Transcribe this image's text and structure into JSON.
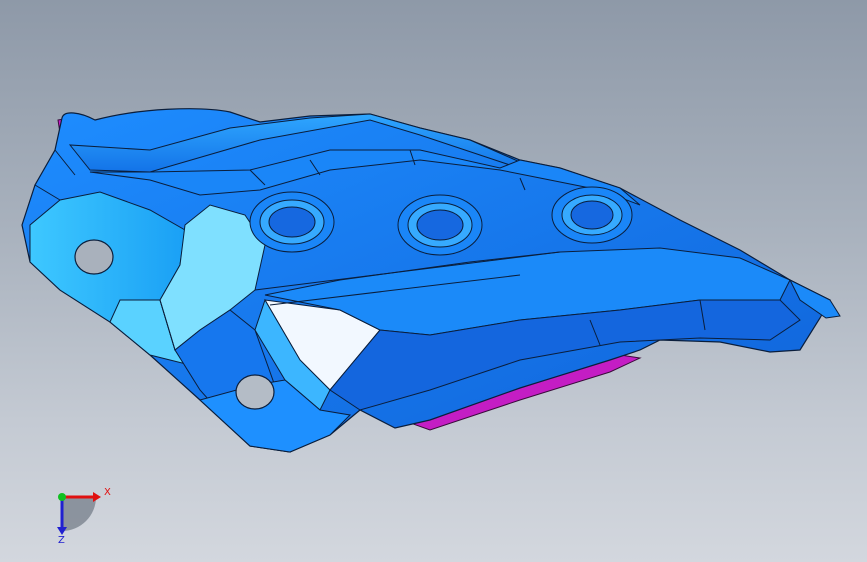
{
  "viewport": {
    "background_top": "#8e99a8",
    "background_bottom": "#d3d7de"
  },
  "model": {
    "face_color": "#1477f0",
    "highlight_color": "#22b4ff",
    "edge_color": "#0a1e3c",
    "underside_color": "#c81ec8"
  },
  "triad": {
    "x_label": "X",
    "z_label": "Z",
    "x_color": "#e01010",
    "y_color": "#10c020",
    "z_color": "#2020d0"
  }
}
